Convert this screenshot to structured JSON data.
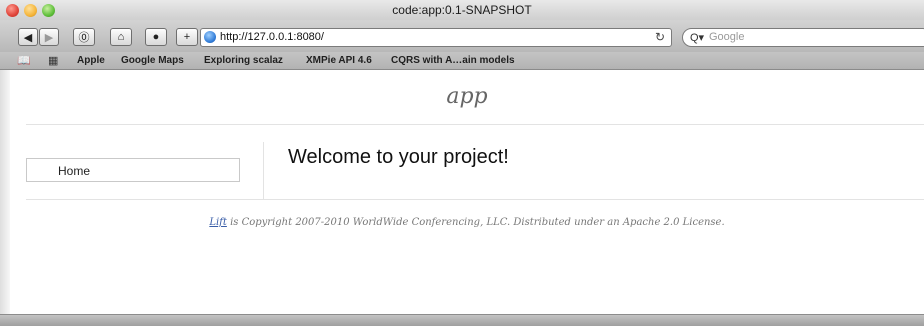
{
  "window": {
    "title": "code:app:0.1-SNAPSHOT"
  },
  "toolbar": {
    "back_icon": "back-arrow-icon",
    "forward_icon": "forward-arrow-icon",
    "url": "http://127.0.0.1:8080/",
    "search_placeholder": "Google"
  },
  "bookmarks": {
    "items": [
      {
        "label": "Apple"
      },
      {
        "label": "Google Maps"
      },
      {
        "label": "Exploring scalaz"
      },
      {
        "label": "XMPie API 4.6"
      },
      {
        "label": "CQRS with A…ain models"
      }
    ]
  },
  "page": {
    "logo": "app",
    "menu_home": "Home",
    "welcome": "Welcome to your project!",
    "footer_link": "Lift",
    "footer_text": " is Copyright 2007-2010 WorldWide Conferencing, LLC. Distributed under an Apache 2.0 License."
  }
}
